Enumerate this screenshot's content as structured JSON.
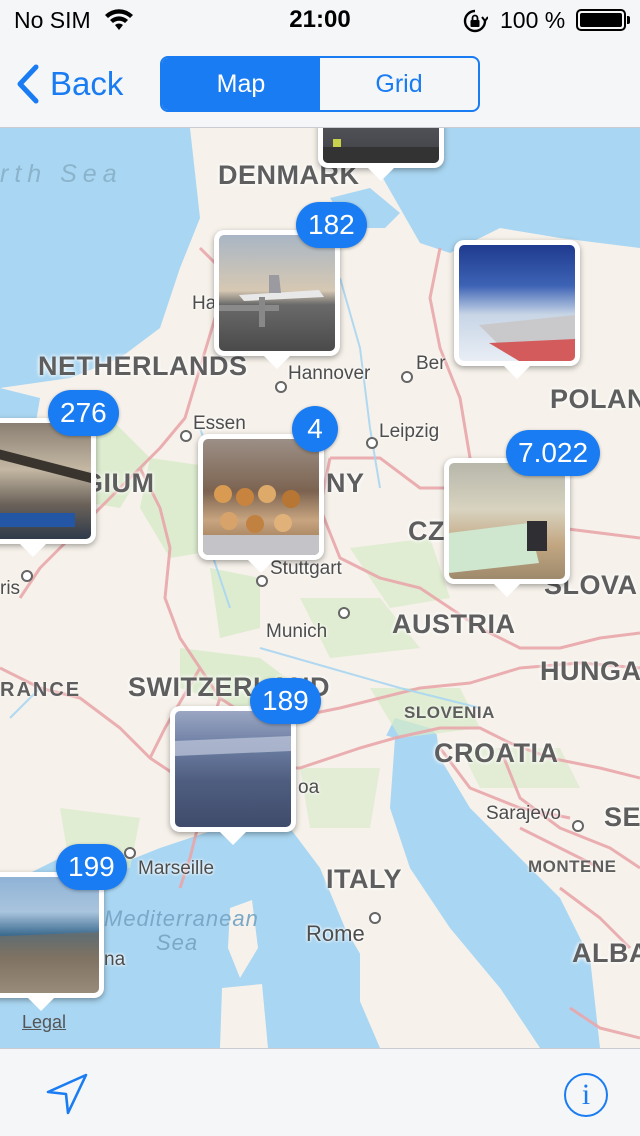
{
  "status_bar": {
    "carrier": "No SIM",
    "time": "21:00",
    "battery_percent": "100 %",
    "battery_level": 1.0,
    "icons": [
      "wifi-icon",
      "rotation-lock-icon",
      "battery-icon"
    ]
  },
  "nav": {
    "back_label": "Back",
    "segments": [
      "Map",
      "Grid"
    ],
    "selected_segment": "Map"
  },
  "map": {
    "countries": {
      "denmark": "DENMARK",
      "netherlands": "NETHERLANDS",
      "belgium_partial": "GIUM",
      "germany_partial": "NY",
      "poland_partial": "POLAN",
      "czech_partial": "CZ",
      "slovakia_partial": "SLOVA",
      "austria": "AUSTRIA",
      "hungary_partial": "HUNGA",
      "france_partial": "RANCE",
      "switzerland": "SWITZERLAND",
      "slovenia": "SLOVENIA",
      "croatia": "CROATIA",
      "serbia_partial": "SE",
      "montenegro_partial": "MONTENE",
      "italy": "ITALY",
      "albania_partial": "ALBA"
    },
    "cities": {
      "hamburg_partial": "Ha",
      "hannover": "Hannover",
      "berlin_partial": "Ber",
      "essen": "Essen",
      "leipzig": "Leipzig",
      "paris_partial": "ris",
      "stuttgart": "Stuttgart",
      "munich": "Munich",
      "genoa_partial": "oa",
      "sarajevo": "Sarajevo",
      "marseille": "Marseille",
      "rome": "Rome",
      "nice_partial": "na"
    },
    "seas": {
      "north_sea_partial": "rth Sea",
      "mediterranean_line1": "Mediterranean",
      "mediterranean_line2": "Sea"
    },
    "legal": "Legal",
    "clusters": [
      {
        "id": "denmark-top",
        "count": null
      },
      {
        "id": "germany-north",
        "count": "182"
      },
      {
        "id": "poland-west",
        "count": null
      },
      {
        "id": "belgium",
        "count": "276"
      },
      {
        "id": "germany-central",
        "count": "4"
      },
      {
        "id": "czech",
        "count": "7.022"
      },
      {
        "id": "switzerland",
        "count": "189"
      },
      {
        "id": "marseille",
        "count": "199"
      }
    ]
  },
  "toolbar": {
    "location_icon": "location-arrow-icon",
    "info_icon": "info-icon",
    "info_glyph": "i"
  },
  "colors": {
    "accent": "#1a7cf2",
    "land": "#f6f1ea",
    "water": "#a9d6f2",
    "border": "#e9a7ab",
    "green": "#cfe7c0"
  }
}
